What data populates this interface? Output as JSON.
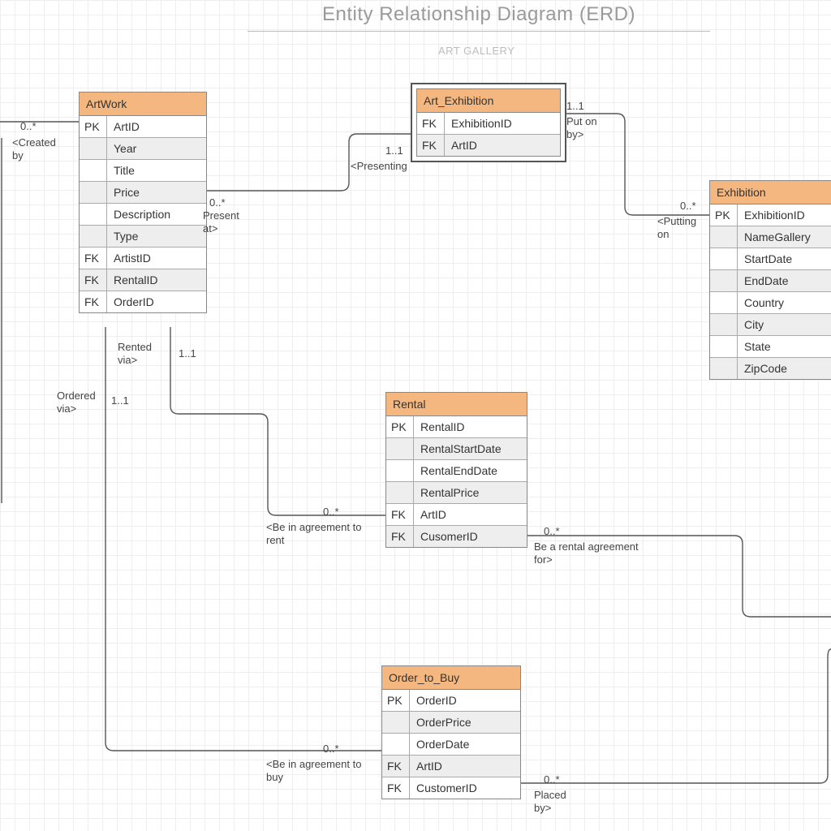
{
  "header": {
    "title": "Entity Relationship Diagram (ERD)",
    "subtitle": "ART GALLERY"
  },
  "entities": {
    "artwork": {
      "name": "ArtWork",
      "rows": [
        {
          "k": "PK",
          "v": "ArtID"
        },
        {
          "k": "",
          "v": "Year",
          "alt": true
        },
        {
          "k": "",
          "v": "Title"
        },
        {
          "k": "",
          "v": "Price",
          "alt": true
        },
        {
          "k": "",
          "v": "Description"
        },
        {
          "k": "",
          "v": "Type",
          "alt": true
        },
        {
          "k": "FK",
          "v": "ArtistID"
        },
        {
          "k": "FK",
          "v": "RentalID",
          "alt": true
        },
        {
          "k": "FK",
          "v": "OrderID"
        }
      ]
    },
    "art_exhibition": {
      "name": "Art_Exhibition",
      "rows": [
        {
          "k": "FK",
          "v": "ExhibitionID"
        },
        {
          "k": "FK",
          "v": "ArtID",
          "alt": true
        }
      ]
    },
    "exhibition": {
      "name": "Exhibition",
      "rows": [
        {
          "k": "PK",
          "v": "ExhibitionID"
        },
        {
          "k": "",
          "v": "NameGallery",
          "alt": true
        },
        {
          "k": "",
          "v": "StartDate"
        },
        {
          "k": "",
          "v": "EndDate",
          "alt": true
        },
        {
          "k": "",
          "v": "Country"
        },
        {
          "k": "",
          "v": "City",
          "alt": true
        },
        {
          "k": "",
          "v": "State"
        },
        {
          "k": "",
          "v": "ZipCode",
          "alt": true
        }
      ]
    },
    "rental": {
      "name": "Rental",
      "rows": [
        {
          "k": "PK",
          "v": "RentalID"
        },
        {
          "k": "",
          "v": "RentalStartDate",
          "alt": true
        },
        {
          "k": "",
          "v": "RentalEndDate"
        },
        {
          "k": "",
          "v": "RentalPrice",
          "alt": true
        },
        {
          "k": "FK",
          "v": "ArtID"
        },
        {
          "k": "FK",
          "v": "CusomerID",
          "alt": true
        }
      ]
    },
    "order": {
      "name": "Order_to_Buy",
      "rows": [
        {
          "k": "PK",
          "v": "OrderID"
        },
        {
          "k": "",
          "v": "OrderPrice",
          "alt": true
        },
        {
          "k": "",
          "v": "OrderDate"
        },
        {
          "k": "FK",
          "v": "ArtID",
          "alt": true
        },
        {
          "k": "FK",
          "v": "CustomerID"
        }
      ]
    }
  },
  "labels": {
    "created_by": {
      "m": "0..*",
      "t": "<Created\nby"
    },
    "presenting": {
      "m": "1..1",
      "t": "<Presenting"
    },
    "present_at": {
      "m": "0..*",
      "t": "Present\nat>"
    },
    "put_on_by": {
      "m": "1..1",
      "t": "Put on\nby>"
    },
    "putting_on": {
      "m": "0..*",
      "t": "<Putting\non"
    },
    "rented_via": {
      "m": "1..1",
      "t": "Rented\nvia>"
    },
    "ordered_via": {
      "m": "1..1",
      "t": "Ordered\nvia>"
    },
    "agree_rent": {
      "m": "0..*",
      "t": "<Be in agreement to\nrent"
    },
    "rental_for": {
      "m": "0..*",
      "t": "Be a rental agreement\nfor>"
    },
    "agree_buy": {
      "m": "0..*",
      "t": "<Be in agreement to\nbuy"
    },
    "placed_by": {
      "m": "0..*",
      "t": "Placed\nby>"
    }
  }
}
